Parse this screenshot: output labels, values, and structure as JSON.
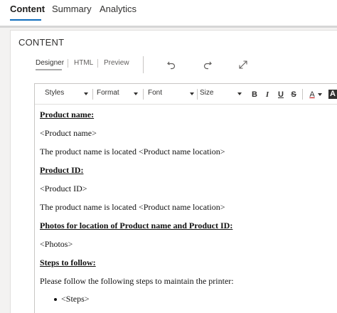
{
  "tabs": [
    {
      "label": "Content",
      "active": true
    },
    {
      "label": "Summary",
      "active": false
    },
    {
      "label": "Analytics",
      "active": false
    }
  ],
  "section_title": "CONTENT",
  "view_tabs": [
    {
      "label": "Designer",
      "active": true
    },
    {
      "label": "HTML",
      "active": false
    },
    {
      "label": "Preview",
      "active": false
    }
  ],
  "toolbar_icons": [
    "undo-icon",
    "redo-icon",
    "expand-icon"
  ],
  "editor_toolbar": {
    "styles_label": "Styles",
    "format_label": "Format",
    "font_label": "Font",
    "size_label": "Size",
    "bold": "B",
    "italic": "I",
    "underline": "U",
    "strikethrough": "S",
    "font_color": "A",
    "highlight": "A"
  },
  "body": {
    "heading_product_name": "Product name:",
    "product_name_placeholder": "<Product name>",
    "product_name_location": "The product name is located <Product name location>",
    "heading_product_id": "Product ID:",
    "product_id_placeholder": "<Product ID>",
    "product_id_location": "The product name is located <Product name location>",
    "heading_photos": "Photos for location of Product name and Product ID:",
    "photos_placeholder": "<Photos>",
    "heading_steps": "Steps to follow:",
    "steps_intro": "Please follow the following steps to maintain the printer:",
    "steps_list": [
      "<Steps>"
    ]
  },
  "colors": {
    "accent": "#0f6cbd",
    "text": "#323130",
    "border": "#c8c6c4"
  }
}
